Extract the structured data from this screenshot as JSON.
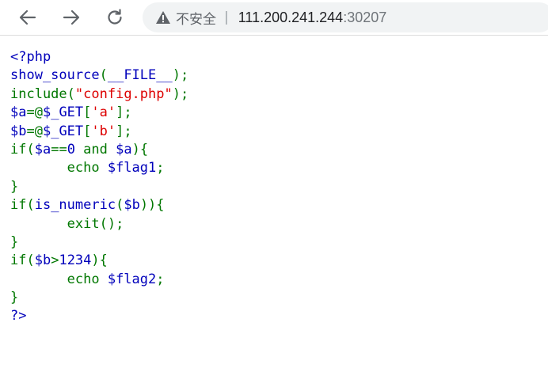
{
  "browser": {
    "security_label": "不安全",
    "separator": "|",
    "url_host": "111.200.241.244",
    "url_port": ":30207",
    "icons": {
      "back": "arrow-left-icon",
      "forward": "arrow-right-icon",
      "reload": "reload-icon",
      "security": "warning-triangle-icon"
    }
  },
  "code": {
    "colors": {
      "default": "#0000bb",
      "keyword": "#007700",
      "string": "#dd0000"
    },
    "lines": [
      [
        {
          "t": "<?php",
          "c": "default"
        }
      ],
      [
        {
          "t": "show_source",
          "c": "default"
        },
        {
          "t": "(",
          "c": "keyword"
        },
        {
          "t": "__FILE__",
          "c": "default"
        },
        {
          "t": ");",
          "c": "keyword"
        }
      ],
      [
        {
          "t": "include",
          "c": "keyword"
        },
        {
          "t": "(",
          "c": "keyword"
        },
        {
          "t": "\"config.php\"",
          "c": "string"
        },
        {
          "t": ");",
          "c": "keyword"
        }
      ],
      [
        {
          "t": "$a",
          "c": "default"
        },
        {
          "t": "=@",
          "c": "keyword"
        },
        {
          "t": "$_GET",
          "c": "default"
        },
        {
          "t": "[",
          "c": "keyword"
        },
        {
          "t": "'a'",
          "c": "string"
        },
        {
          "t": "];",
          "c": "keyword"
        }
      ],
      [
        {
          "t": "$b",
          "c": "default"
        },
        {
          "t": "=@",
          "c": "keyword"
        },
        {
          "t": "$_GET",
          "c": "default"
        },
        {
          "t": "[",
          "c": "keyword"
        },
        {
          "t": "'b'",
          "c": "string"
        },
        {
          "t": "];",
          "c": "keyword"
        }
      ],
      [
        {
          "t": "if(",
          "c": "keyword"
        },
        {
          "t": "$a",
          "c": "default"
        },
        {
          "t": "==",
          "c": "keyword"
        },
        {
          "t": "0 ",
          "c": "default"
        },
        {
          "t": "and ",
          "c": "keyword"
        },
        {
          "t": "$a",
          "c": "default"
        },
        {
          "t": "){",
          "c": "keyword"
        }
      ],
      [
        {
          "t": "       echo ",
          "c": "keyword"
        },
        {
          "t": "$flag1",
          "c": "default"
        },
        {
          "t": ";",
          "c": "keyword"
        }
      ],
      [
        {
          "t": "}",
          "c": "keyword"
        }
      ],
      [
        {
          "t": "if(",
          "c": "keyword"
        },
        {
          "t": "is_numeric",
          "c": "default"
        },
        {
          "t": "(",
          "c": "keyword"
        },
        {
          "t": "$b",
          "c": "default"
        },
        {
          "t": ")){",
          "c": "keyword"
        }
      ],
      [
        {
          "t": "       exit",
          "c": "keyword"
        },
        {
          "t": "();",
          "c": "keyword"
        }
      ],
      [
        {
          "t": "}",
          "c": "keyword"
        }
      ],
      [
        {
          "t": "if(",
          "c": "keyword"
        },
        {
          "t": "$b",
          "c": "default"
        },
        {
          "t": ">",
          "c": "keyword"
        },
        {
          "t": "1234",
          "c": "default"
        },
        {
          "t": "){",
          "c": "keyword"
        }
      ],
      [
        {
          "t": "       echo ",
          "c": "keyword"
        },
        {
          "t": "$flag2",
          "c": "default"
        },
        {
          "t": ";",
          "c": "keyword"
        }
      ],
      [
        {
          "t": "}",
          "c": "keyword"
        }
      ],
      [
        {
          "t": "?>",
          "c": "default"
        }
      ]
    ]
  }
}
